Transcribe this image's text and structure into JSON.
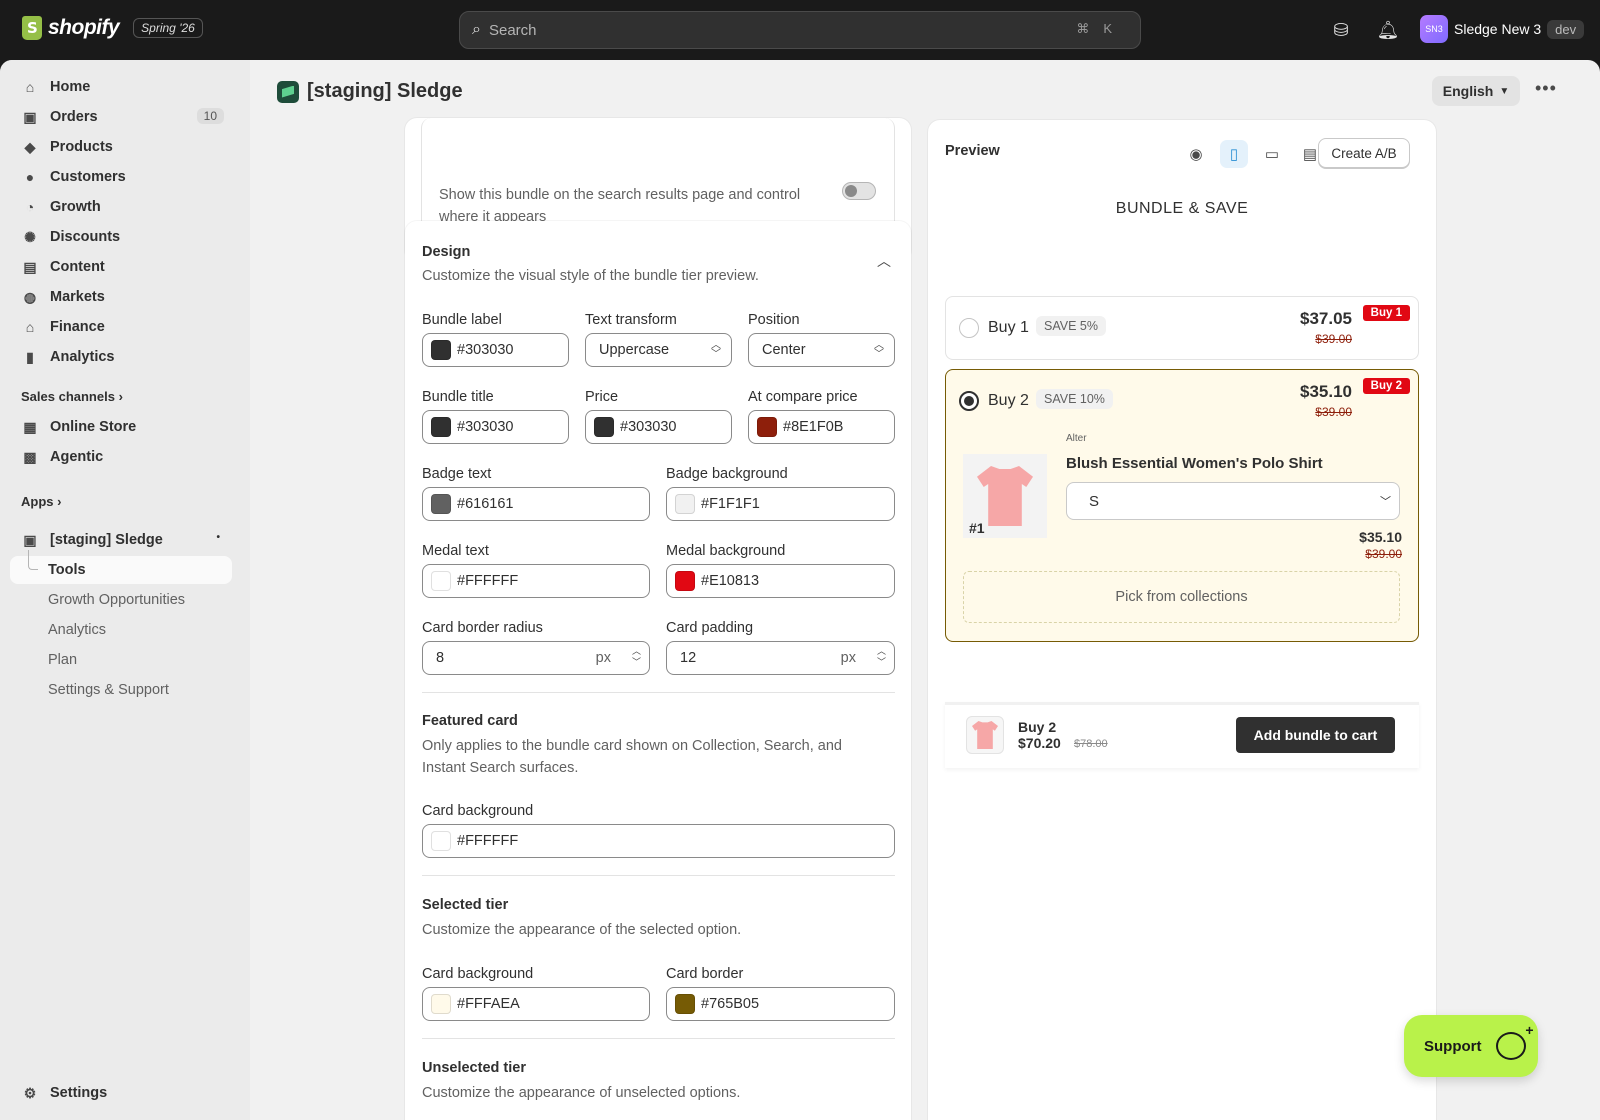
{
  "topbar": {
    "brand": "shopify",
    "edition": "Spring '26",
    "search_placeholder": "Search",
    "search_shortcut": "⌘K",
    "store_initials": "SN3",
    "store_name": "Sledge New 3",
    "store_badge": "dev"
  },
  "sidebar": {
    "items": [
      {
        "label": "Home",
        "icon": "home-icon"
      },
      {
        "label": "Orders",
        "icon": "orders-icon",
        "count": "10"
      },
      {
        "label": "Products",
        "icon": "tag-icon"
      },
      {
        "label": "Customers",
        "icon": "person-icon"
      },
      {
        "label": "Growth",
        "icon": "growth-icon"
      },
      {
        "label": "Discounts",
        "icon": "discount-icon"
      },
      {
        "label": "Content",
        "icon": "content-icon"
      },
      {
        "label": "Markets",
        "icon": "globe-icon"
      },
      {
        "label": "Finance",
        "icon": "bank-icon"
      },
      {
        "label": "Analytics",
        "icon": "bar-chart-icon"
      }
    ],
    "sales_channels_label": "Sales channels",
    "channels": [
      {
        "label": "Online Store",
        "icon": "store-icon"
      },
      {
        "label": "Agentic",
        "icon": "agentic-icon"
      }
    ],
    "apps_label": "Apps",
    "app": {
      "label": "[staging] Sledge",
      "sub_items": [
        "Tools",
        "Growth Opportunities",
        "Analytics",
        "Plan",
        "Settings & Support"
      ]
    },
    "settings_label": "Settings"
  },
  "page": {
    "title": "[staging] Sledge",
    "language": "English"
  },
  "search_card": {
    "description": "Show this bundle on the search results page and control where it appears"
  },
  "design": {
    "title": "Design",
    "subtitle": "Customize the visual style of the bundle tier preview.",
    "bundle_label": {
      "label": "Bundle label",
      "value": "#303030",
      "color": "#303030"
    },
    "text_transform": {
      "label": "Text transform",
      "value": "Uppercase"
    },
    "position": {
      "label": "Position",
      "value": "Center"
    },
    "bundle_title": {
      "label": "Bundle title",
      "value": "#303030",
      "color": "#303030"
    },
    "price": {
      "label": "Price",
      "value": "#303030",
      "color": "#303030"
    },
    "compare_price": {
      "label": "At compare price",
      "value": "#8E1F0B",
      "color": "#8E1F0B"
    },
    "badge_text": {
      "label": "Badge text",
      "value": "#616161",
      "color": "#616161"
    },
    "badge_background": {
      "label": "Badge background",
      "value": "#F1F1F1",
      "color": "#F1F1F1"
    },
    "medal_text": {
      "label": "Medal text",
      "value": "#FFFFFF",
      "color": "#FFFFFF"
    },
    "medal_background": {
      "label": "Medal background",
      "value": "#E10813",
      "color": "#E10813"
    },
    "card_border_radius": {
      "label": "Card border radius",
      "value": "8",
      "unit": "px"
    },
    "card_padding": {
      "label": "Card padding",
      "value": "12",
      "unit": "px"
    },
    "featured_card": {
      "title": "Featured card",
      "description": "Only applies to the bundle card shown on Collection, Search, and Instant Search surfaces.",
      "card_background": {
        "label": "Card background",
        "value": "#FFFFFF",
        "color": "#FFFFFF"
      }
    },
    "selected_tier": {
      "title": "Selected tier",
      "description": "Customize the appearance of the selected option.",
      "card_background": {
        "label": "Card background",
        "value": "#FFFAEA",
        "color": "#FFFAEA"
      },
      "card_border": {
        "label": "Card border",
        "value": "#765B05",
        "color": "#765B05"
      }
    },
    "unselected_tier": {
      "title": "Unselected tier",
      "description": "Customize the appearance of unselected options."
    }
  },
  "preview": {
    "title": "Preview",
    "ab_button": "Create A/B",
    "heading": "BUNDLE & SAVE",
    "tiers": [
      {
        "label": "Buy 1",
        "save": "SAVE 5%",
        "price": "$37.05",
        "compare": "$39.00",
        "medal": "Buy 1"
      },
      {
        "label": "Buy 2",
        "save": "SAVE 10%",
        "price": "$35.10",
        "compare": "$39.00",
        "medal": "Buy 2"
      }
    ],
    "product": {
      "vendor": "Alter",
      "name": "Blush Essential Women's Polo Shirt",
      "rank": "#1",
      "variant": "S",
      "price": "$35.10",
      "compare": "$39.00"
    },
    "pick_label": "Pick from collections",
    "sticky": {
      "label": "Buy 2",
      "price": "$70.20",
      "compare": "$78.00",
      "button": "Add bundle to cart"
    }
  },
  "support_label": "Support"
}
